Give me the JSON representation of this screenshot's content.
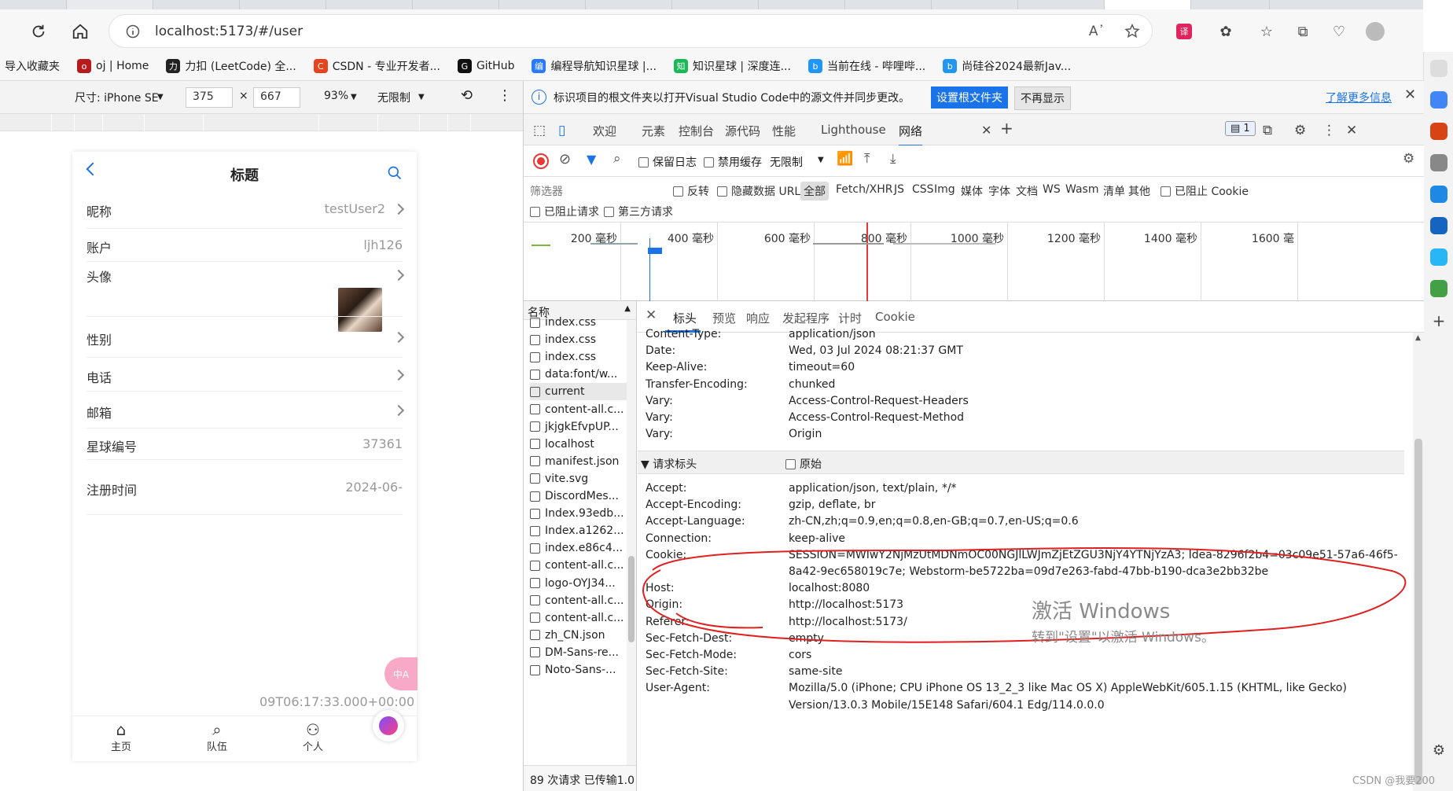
{
  "browser": {
    "url": "localhost:5173/#/user",
    "read_aloud_icon": "read-aloud-icon",
    "bookmarks": [
      {
        "label": "导入收藏夹",
        "icon": "",
        "color": ""
      },
      {
        "label": "oj | Home",
        "icon": "o",
        "color": "#b71c1c"
      },
      {
        "label": "力扣 (LeetCode) 全...",
        "icon": "力",
        "color": "#222"
      },
      {
        "label": "CSDN - 专业开发者...",
        "icon": "C",
        "color": "#e8431f"
      },
      {
        "label": "GitHub",
        "icon": "G",
        "color": "#111"
      },
      {
        "label": "编程导航知识星球 |...",
        "icon": "编",
        "color": "#2979ff"
      },
      {
        "label": "知识星球 | 深度连...",
        "icon": "知",
        "color": "#19b955"
      },
      {
        "label": "当前在线 - 哔哩哔...",
        "icon": "b",
        "color": "#2196f3"
      },
      {
        "label": "尚硅谷2024最新Jav...",
        "icon": "b",
        "color": "#2196f3"
      }
    ]
  },
  "device_toolbar": {
    "size_label": "尺寸: iPhone SE",
    "width": "375",
    "x": "×",
    "height": "667",
    "zoom": "93%",
    "throttle": "无限制",
    "more": "⋮"
  },
  "phone": {
    "title": "标题",
    "rows": [
      {
        "label": "昵称",
        "value": "testUser2",
        "chevron": true
      },
      {
        "label": "账户",
        "value": "ljh126",
        "chevron": false
      },
      {
        "label": "头像",
        "value": "",
        "chevron": true
      },
      {
        "label": "性别",
        "value": "",
        "chevron": true
      },
      {
        "label": "电话",
        "value": "",
        "chevron": true
      },
      {
        "label": "邮箱",
        "value": "",
        "chevron": true
      },
      {
        "label": "星球编号",
        "value": "37361",
        "chevron": false
      },
      {
        "label": "注册时间",
        "value": "2024-06-",
        "chevron": false
      }
    ],
    "reg_time_line2": "09T06:17:33.000+00:00",
    "float_badge": "中A",
    "tabs": [
      {
        "label": "主页",
        "icon": "home-icon"
      },
      {
        "label": "队伍",
        "icon": "search-icon"
      },
      {
        "label": "个人",
        "icon": "user-icon"
      }
    ]
  },
  "devtools": {
    "info_text": "标识项目的根文件夹以打开Visual Studio Code中的源文件并同步更改。",
    "info_btn1": "设置根文件夹",
    "info_btn2": "不再显示",
    "info_link": "了解更多信息",
    "tabs": [
      "欢迎",
      "元素",
      "控制台",
      "源代码",
      "性能",
      "Lighthouse",
      "网络"
    ],
    "issues_count": "1",
    "toolbar": {
      "preserve_log": "保留日志",
      "disable_cache": "禁用缓存",
      "throttle": "无限制"
    },
    "filter": {
      "placeholder": "筛选器",
      "invert": "反转",
      "hide_data_urls": "隐藏数据 URL",
      "types": [
        "全部",
        "Fetch/XHR",
        "JS",
        "CSS",
        "Img",
        "媒体",
        "字体",
        "文档",
        "WS",
        "Wasm",
        "清单",
        "其他"
      ],
      "blocked_cookies": "已阻止 Cookie",
      "blocked_requests": "已阻止请求",
      "third_party": "第三方请求"
    },
    "timeline_labels": [
      "200 毫秒",
      "400 毫秒",
      "600 毫秒",
      "800 毫秒",
      "1000 毫秒",
      "1200 毫秒",
      "1400 毫秒",
      "1600 毫"
    ],
    "name_header": "名称",
    "requests": [
      "index.css",
      "index.css",
      "index.css",
      "data:font/w...",
      "current",
      "content-all.c...",
      "jkjgkEfvpUP...",
      "localhost",
      "manifest.json",
      "vite.svg",
      "DiscordMes...",
      "Index.93edb...",
      "Index.a1262...",
      "index.e86c4...",
      "content-all.c...",
      "logo-OYJ34...",
      "content-all.c...",
      "content-all.c...",
      "zh_CN.json",
      "DM-Sans-re...",
      "Noto-Sans-..."
    ],
    "status": "89 次请求  已传输1.0",
    "detail_tabs": [
      "标头",
      "预览",
      "响应",
      "发起程序",
      "计时",
      "Cookie"
    ],
    "response_headers": [
      {
        "k": "Content-Type:",
        "v": "application/json"
      },
      {
        "k": "Date:",
        "v": "Wed, 03 Jul 2024 08:21:37 GMT"
      },
      {
        "k": "Keep-Alive:",
        "v": "timeout=60"
      },
      {
        "k": "Transfer-Encoding:",
        "v": "chunked"
      },
      {
        "k": "Vary:",
        "v": "Access-Control-Request-Headers"
      },
      {
        "k": "Vary:",
        "v": "Access-Control-Request-Method"
      },
      {
        "k": "Vary:",
        "v": "Origin"
      }
    ],
    "request_section": "▼ 请求标头",
    "raw": "原始",
    "request_headers": [
      {
        "k": "Accept:",
        "v": "application/json, text/plain, */*"
      },
      {
        "k": "Accept-Encoding:",
        "v": "gzip, deflate, br"
      },
      {
        "k": "Accept-Language:",
        "v": "zh-CN,zh;q=0.9,en;q=0.8,en-GB;q=0.7,en-US;q=0.6"
      },
      {
        "k": "Connection:",
        "v": "keep-alive"
      },
      {
        "k": "Cookie:",
        "v": "SESSION=MWIwY2NjMzUtMDNmOC00NGJlLWJmZjEtZGU3NjY4YTNjYzA3; Idea-8296f2b4=03c09e51-57a6-46f5-"
      },
      {
        "k": "",
        "v": "8a42-9ec658019c7e; Webstorm-be5722ba=09d7e263-fabd-47bb-b190-dca3e2bb32be"
      },
      {
        "k": "Host:",
        "v": "localhost:8080"
      },
      {
        "k": "Origin:",
        "v": "http://localhost:5173"
      },
      {
        "k": "Referer:",
        "v": "http://localhost:5173/"
      },
      {
        "k": "Sec-Fetch-Dest:",
        "v": "empty"
      },
      {
        "k": "Sec-Fetch-Mode:",
        "v": "cors"
      },
      {
        "k": "Sec-Fetch-Site:",
        "v": "same-site"
      },
      {
        "k": "User-Agent:",
        "v": "Mozilla/5.0 (iPhone; CPU iPhone OS 13_2_3 like Mac OS X) AppleWebKit/605.1.15 (KHTML, like Gecko)"
      },
      {
        "k": "",
        "v": "Version/13.0.3 Mobile/15E148 Safari/604.1 Edg/114.0.0.0"
      }
    ]
  },
  "watermark": {
    "line1": "激活 Windows",
    "line2": "转到\"设置\"以激活 Windows。"
  },
  "credit": "CSDN @我要200",
  "colors": {
    "accent": "#1a73e8",
    "circle": "#e02020",
    "record": "#e53935"
  }
}
